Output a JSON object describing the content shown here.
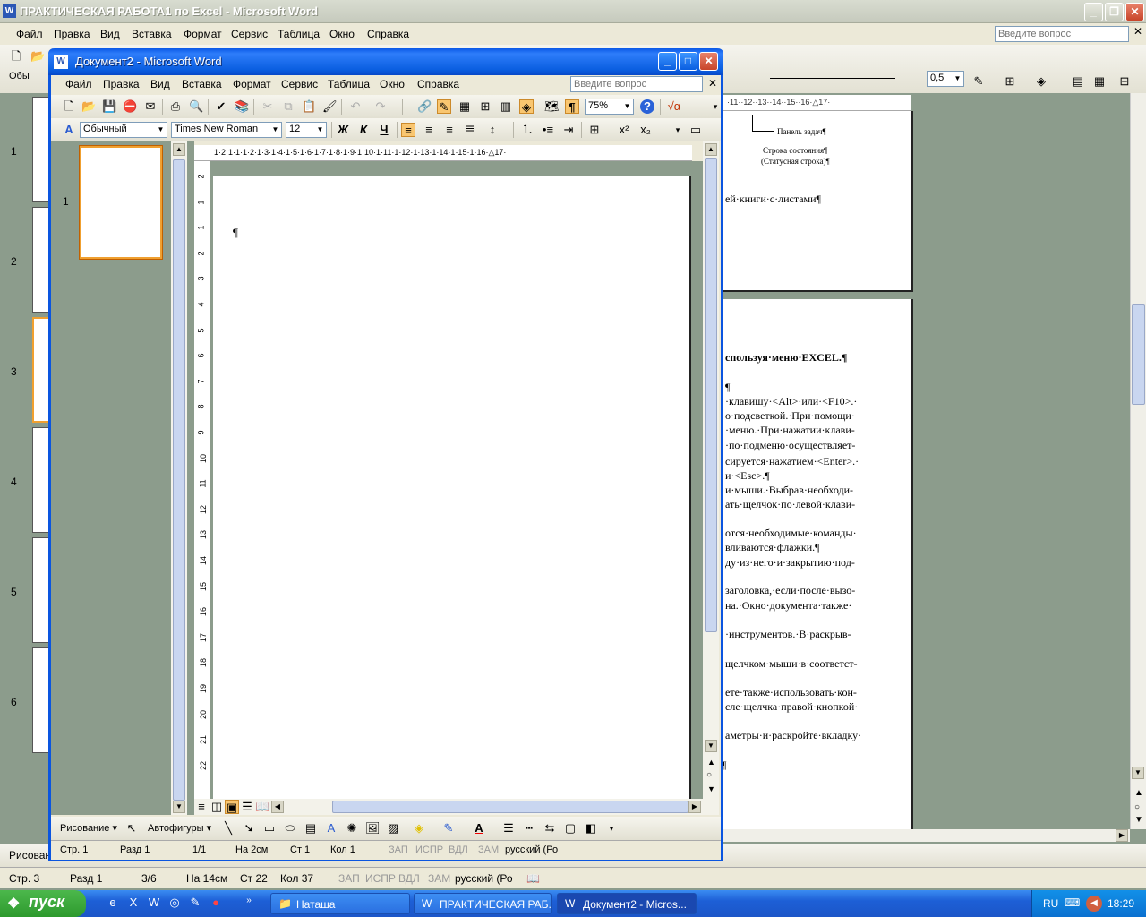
{
  "back_window": {
    "title": "ПРАКТИЧЕСКАЯ РАБОТА1 по Excel - Microsoft Word",
    "menu": [
      "Файл",
      "Правка",
      "Вид",
      "Вставка",
      "Формат",
      "Сервис",
      "Таблица",
      "Окно",
      "Справка"
    ],
    "ask_placeholder": "Введите вопрос",
    "line_width": "0,5",
    "page_numbers": [
      "1",
      "2",
      "3",
      "4",
      "5",
      "6"
    ],
    "ruler_text": "·11··12··13··14··15··16·△17·",
    "annotations": [
      "Панель задач¶",
      "Строка состояния¶",
      "(Статусная строка)¶"
    ],
    "lines": [
      "ей·книги·с·листами¶",
      "спользуя·меню·EXCEL.¶",
      "¶",
      "·клавишу·<Alt>·или·<F10>.·",
      "о·подсветкой.·При·помощи·",
      "·меню.·При·нажатии·клави-",
      "·по·подменю·осуществляет-",
      "сируется·нажатием·<Enter>.·",
      "и·<Esc>.¶",
      "и·мыши.·Выбрав·необходи-",
      "ать·щелчок·по·левой·клави-",
      "отся·необходимые·команды·",
      "вливаются·флажки.¶",
      "ду·из·него·и·закрытию·под-",
      "заголовка,·если·после·вызо-",
      "на.·Окно·документа·также·",
      "·инструментов.·В·раскрыв-",
      "щелчком·мыши·в·соответст-",
      "ете·также·использовать·кон-",
      "сле·щелчка·правой·кнопкой·",
      "аметры·и·раскройте·вкладку·",
      "¶"
    ],
    "drawing_label": "Рисован",
    "status": {
      "page": "Стр. 3",
      "section": "Разд 1",
      "pages": "3/6",
      "at": "На 14см",
      "line": "Ст 22",
      "col": "Кол 37",
      "rec": "ЗАП",
      "trk": "ИСПР",
      "ext": "ВДЛ",
      "ovr": "ЗАМ",
      "lang": "русский (Ро"
    }
  },
  "front_window": {
    "title": "Документ2 - Microsoft Word",
    "menu": [
      "Файл",
      "Правка",
      "Вид",
      "Вставка",
      "Формат",
      "Сервис",
      "Таблица",
      "Окно",
      "Справка"
    ],
    "ask_placeholder": "Введите вопрос",
    "zoom": "75%",
    "style": "Обычный",
    "font": "Times New Roman",
    "size": "12",
    "bold": "Ж",
    "italic": "К",
    "underline": "Ч",
    "thumb_number": "1",
    "paragraph_mark": "¶",
    "ruler_text": "1·2·1·1·1·2·1·3·1·4·1·5·1·6·1·7·1·8·1·9·1·10·1·11·1·12·1·13·1·14·1·15·1·16·△17·",
    "vruler_numbers": [
      "2",
      "1",
      "1",
      "2",
      "3",
      "4",
      "5",
      "6",
      "7",
      "8",
      "9",
      "10",
      "11",
      "12",
      "13",
      "14",
      "15",
      "16",
      "17",
      "18",
      "19",
      "20",
      "21",
      "22"
    ],
    "drawing": {
      "draw_label": "Рисование ▾",
      "autoshapes_label": "Автофигуры ▾"
    },
    "status": {
      "page": "Стр. 1",
      "section": "Разд 1",
      "pages": "1/1",
      "at": "На 2см",
      "line": "Ст 1",
      "col": "Кол 1",
      "rec": "ЗАП",
      "trk": "ИСПР",
      "ext": "ВДЛ",
      "ovr": "ЗАМ",
      "lang": "русский (Ро"
    }
  },
  "taskbar": {
    "start": "пуск",
    "tasks": [
      "Наташа",
      "ПРАКТИЧЕСКАЯ РАБ...",
      "Документ2 - Micros..."
    ],
    "lang": "RU",
    "time": "18:29"
  }
}
